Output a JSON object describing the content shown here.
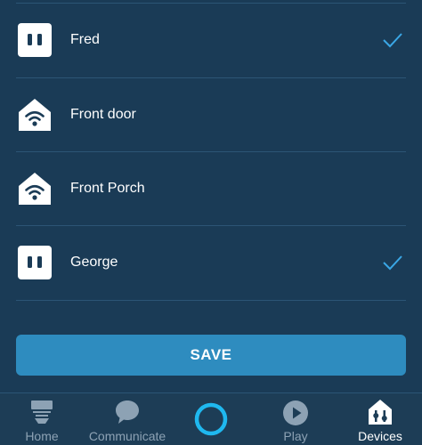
{
  "devices": [
    {
      "name": "Fred",
      "icon": "smart-plug-icon",
      "selected": true
    },
    {
      "name": "Front door",
      "icon": "wifi-home-icon",
      "selected": false
    },
    {
      "name": "Front Porch",
      "icon": "wifi-home-icon",
      "selected": false
    },
    {
      "name": "George",
      "icon": "smart-plug-icon",
      "selected": true
    }
  ],
  "save_button": {
    "label": "SAVE"
  },
  "nav": {
    "home": {
      "label": "Home",
      "icon": "home-icon"
    },
    "communicate": {
      "label": "Communicate",
      "icon": "chat-bubble-icon"
    },
    "alexa": {
      "label": "",
      "icon": "alexa-ring-icon"
    },
    "play": {
      "label": "Play",
      "icon": "play-icon"
    },
    "devices": {
      "label": "Devices",
      "icon": "devices-icon",
      "active": true
    }
  },
  "colors": {
    "background": "#1a3b56",
    "accent": "#2e8cbf",
    "check": "#3aa7e6",
    "alexa_ring": "#1fb8ef"
  }
}
